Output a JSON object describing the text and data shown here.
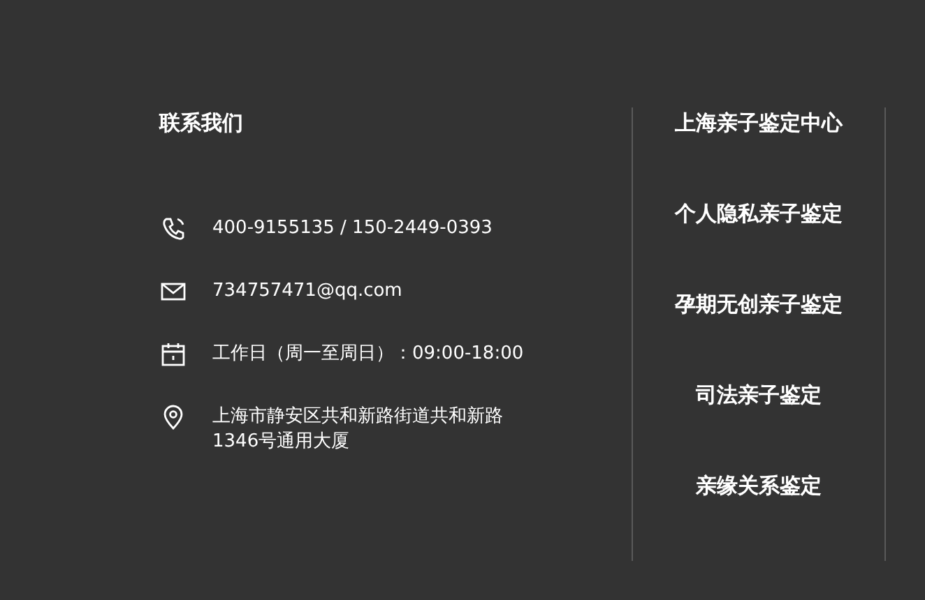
{
  "contact": {
    "title": "联系我们",
    "items": [
      {
        "kind": "phone",
        "text": "400-9155135 / 150-2449-0393"
      },
      {
        "kind": "email",
        "text": "734757471@qq.com"
      },
      {
        "kind": "hours",
        "text": "工作日（周一至周日）：09:00-18:00"
      },
      {
        "kind": "address",
        "lines": [
          "上海市静安区共和新路街道共和新路",
          "1346号通用大厦"
        ]
      }
    ]
  },
  "links": [
    "上海亲子鉴定中心",
    "个人隐私亲子鉴定",
    "孕期无创亲子鉴定",
    "司法亲子鉴定",
    "亲缘关系鉴定"
  ]
}
